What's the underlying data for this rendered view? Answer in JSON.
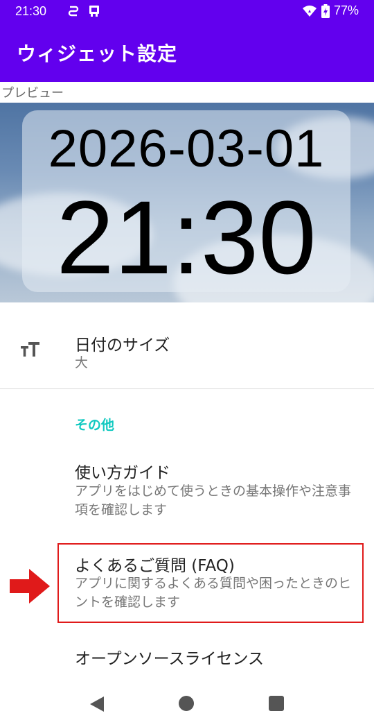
{
  "status_bar": {
    "time": "21:30",
    "battery": "77%",
    "icons": [
      "sync-icon",
      "device-icon",
      "wifi-icon",
      "battery-icon"
    ]
  },
  "app_bar": {
    "title": "ウィジェット設定"
  },
  "preview": {
    "label": "プレビュー",
    "date": "2026-03-01",
    "time": "21:30"
  },
  "settings": {
    "date_size": {
      "title": "日付のサイズ",
      "value": "大",
      "icon": "text-size-icon"
    }
  },
  "others": {
    "header": "その他",
    "items": [
      {
        "title": "使い方ガイド",
        "subtitle": "アプリをはじめて使うときの基本操作や注意事項を確認します"
      },
      {
        "title": "よくあるご質問 (FAQ)",
        "subtitle": "アプリに関するよくある質問や困ったときのヒントを確認します"
      },
      {
        "title": "オープンソースライセンス"
      }
    ]
  },
  "colors": {
    "primary": "#6200ee",
    "accent": "#10c9c0",
    "highlight": "#e01a1a"
  },
  "nav_bar": {
    "icons": [
      "back-icon",
      "home-icon",
      "recents-icon"
    ]
  }
}
